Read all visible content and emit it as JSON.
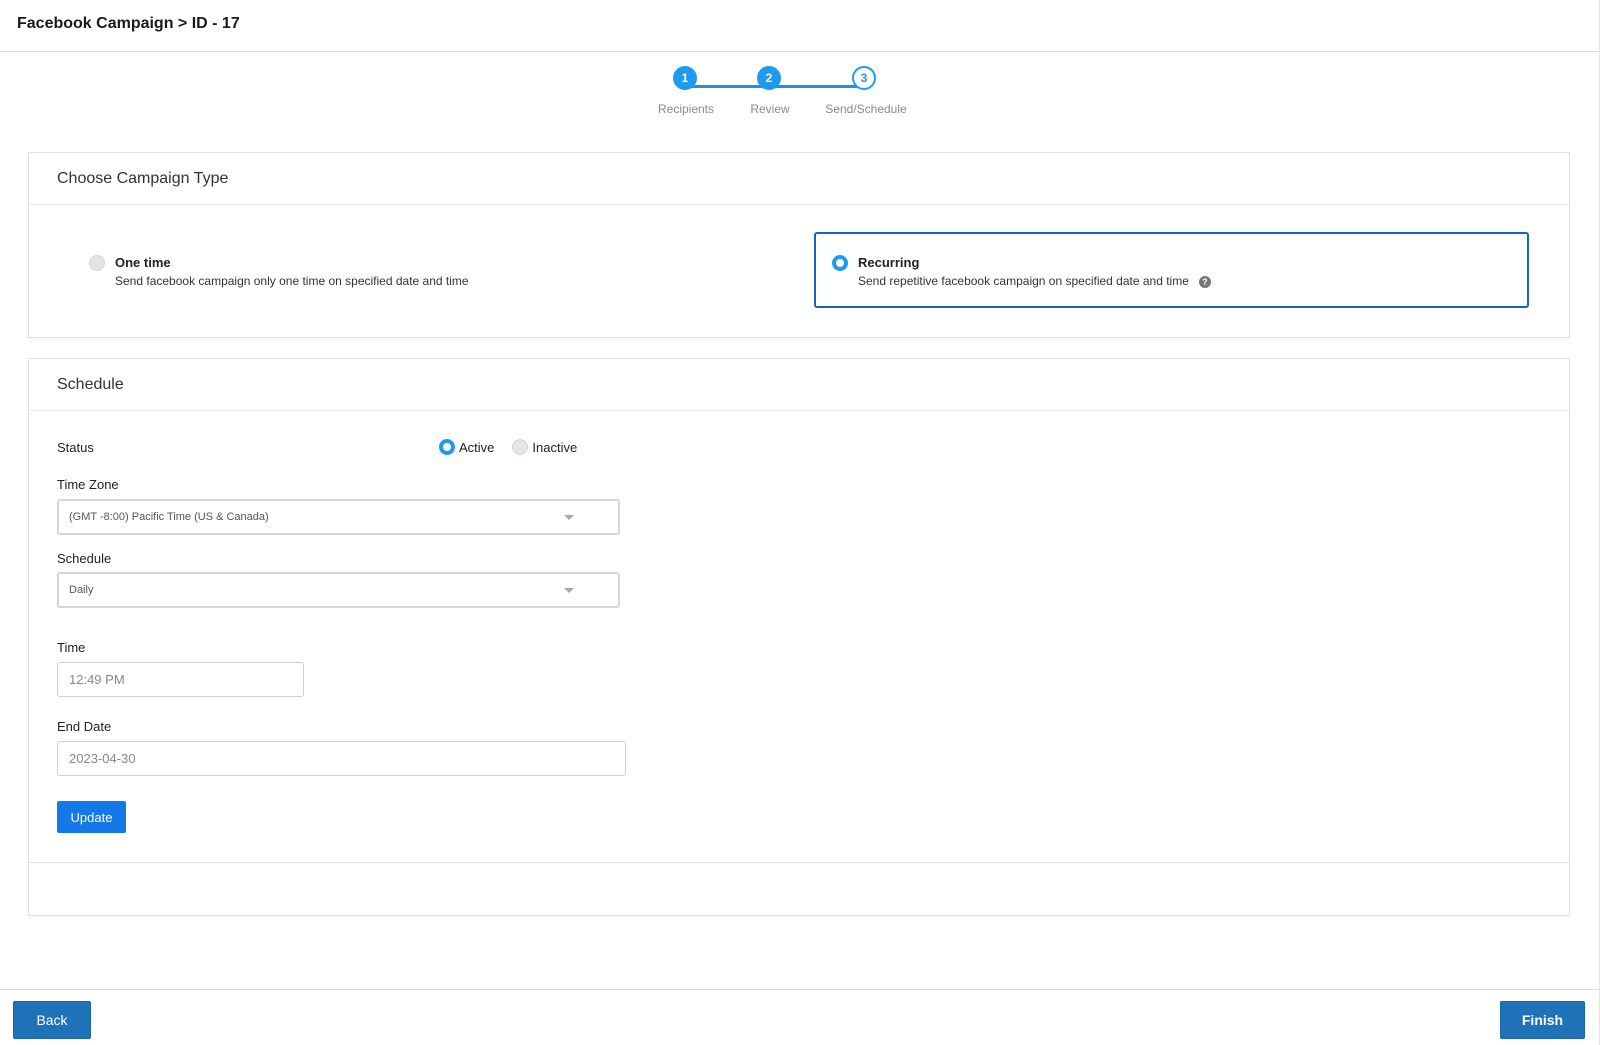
{
  "header": {
    "title": "Facebook Campaign > ID - 17"
  },
  "stepper": {
    "steps": [
      {
        "number": "1",
        "label": "Recipients",
        "state": "complete"
      },
      {
        "number": "2",
        "label": "Review",
        "state": "complete"
      },
      {
        "number": "3",
        "label": "Send/Schedule",
        "state": "current"
      }
    ]
  },
  "campaign_type": {
    "heading": "Choose Campaign Type",
    "one_time": {
      "title": "One time",
      "description": "Send facebook campaign only one time on specified date and time",
      "selected": false
    },
    "recurring": {
      "title": "Recurring",
      "description": "Send repetitive facebook campaign on specified date and time",
      "selected": true,
      "help_icon": "?"
    }
  },
  "schedule": {
    "heading": "Schedule",
    "status_label": "Status",
    "status_options": [
      {
        "label": "Active",
        "selected": true
      },
      {
        "label": "Inactive",
        "selected": false
      }
    ],
    "timezone_label": "Time Zone",
    "timezone_value": "(GMT -8:00) Pacific Time (US & Canada)",
    "schedule_label": "Schedule",
    "schedule_value": "Daily",
    "time_label": "Time",
    "time_placeholder": "12:49 PM",
    "end_date_label": "End Date",
    "end_date_placeholder": "2023-04-30",
    "update_label": "Update"
  },
  "footer": {
    "back_label": "Back",
    "finish_label": "Finish"
  },
  "colors": {
    "accent": "#1e9bf0",
    "primary_button": "#1f72b8",
    "update_button": "#1478e8",
    "selected_border": "#1565c0"
  }
}
